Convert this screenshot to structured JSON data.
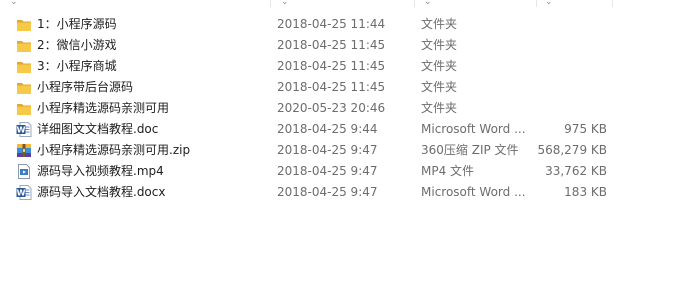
{
  "rows": [
    {
      "icon": "folder-icon",
      "name": "1：小程序源码",
      "date": "2018-04-25 11:44",
      "type": "文件夹",
      "size": ""
    },
    {
      "icon": "folder-icon",
      "name": "2：微信小游戏",
      "date": "2018-04-25 11:45",
      "type": "文件夹",
      "size": ""
    },
    {
      "icon": "folder-icon",
      "name": "3：小程序商城",
      "date": "2018-04-25 11:45",
      "type": "文件夹",
      "size": ""
    },
    {
      "icon": "folder-icon",
      "name": "小程序带后台源码",
      "date": "2018-04-25 11:45",
      "type": "文件夹",
      "size": ""
    },
    {
      "icon": "folder-icon",
      "name": "小程序精选源码亲测可用",
      "date": "2020-05-23 20:46",
      "type": "文件夹",
      "size": ""
    },
    {
      "icon": "word-doc-icon",
      "name": "详细图文文档教程.doc",
      "date": "2018-04-25 9:44",
      "type": "Microsoft Word ...",
      "size": "975 KB"
    },
    {
      "icon": "zip-archive-icon",
      "name": "小程序精选源码亲测可用.zip",
      "date": "2018-04-25 9:47",
      "type": "360压缩 ZIP 文件",
      "size": "568,279 KB"
    },
    {
      "icon": "video-file-icon",
      "name": "源码导入视频教程.mp4",
      "date": "2018-04-25 9:47",
      "type": "MP4 文件",
      "size": "33,762 KB"
    },
    {
      "icon": "word-doc-icon",
      "name": "源码导入文档教程.docx",
      "date": "2018-04-25 9:47",
      "type": "Microsoft Word ...",
      "size": "183 KB"
    }
  ],
  "colors": {
    "folder": "#f7c948",
    "folder_dark": "#e0a82e",
    "word_blue": "#2b579a",
    "zip_accent": "#3a8fd6",
    "selection_hover": "#e5f3ff"
  }
}
